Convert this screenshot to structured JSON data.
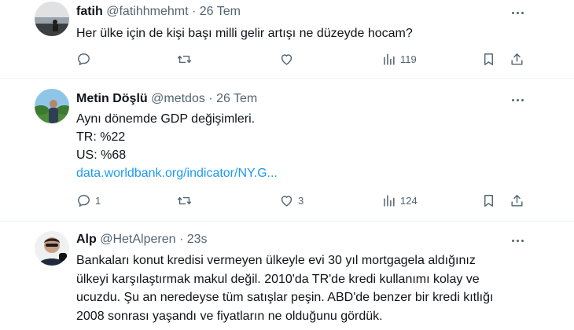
{
  "tweets": [
    {
      "name": "fatih",
      "handle": "@fatihhmehmt",
      "sep": " · ",
      "time": "26 Tem",
      "lines": [
        "Her ülke için de kişi başı milli gelir artışı ne düzeyde hocam?"
      ],
      "replies": "",
      "retweets": "",
      "likes": "",
      "views": "119"
    },
    {
      "name": "Metin Döşlü",
      "handle": "@metdos",
      "sep": " · ",
      "time": "26 Tem",
      "lines": [
        "Aynı dönemde GDP değişimleri.",
        "TR: %22",
        "US: %68"
      ],
      "link": "data.worldbank.org/indicator/NY.G...",
      "replies": "1",
      "retweets": "",
      "likes": "3",
      "views": "124"
    },
    {
      "name": "Alp",
      "handle": "@HetAlperen",
      "sep": " · ",
      "time": "23s",
      "lines": [
        "Bankaları konut kredisi vermeyen ülkeyle evi 30 yıl mortgagela aldığınız",
        "ülkeyi karşılaştırmak makul değil. 2010'da TR'de kredi kullanımı kolay ve",
        "ucuzdu. Şu an neredeyse tüm satışlar peşin. ABD'de benzer bir kredi kıtlığı",
        "2008 sonrası yaşandı ve fiyatların ne olduğunu gördük."
      ]
    }
  ],
  "icons": {
    "reply": "reply-icon",
    "retweet": "retweet-icon",
    "like": "heart-icon",
    "views": "views-icon",
    "bookmark": "bookmark-icon",
    "share": "share-icon",
    "more": "more-icon"
  },
  "colors": {
    "text": "#0f1419",
    "muted": "#536471",
    "link": "#1d9bf0",
    "divider": "#eff3f4"
  }
}
